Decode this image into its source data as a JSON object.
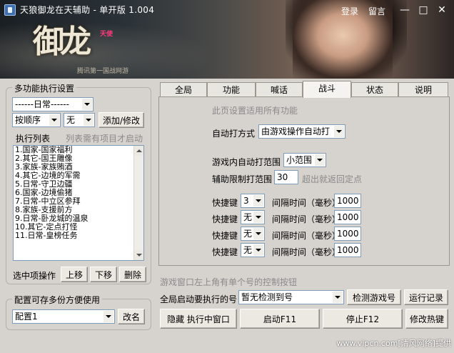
{
  "window": {
    "title": "天狼御龙在天辅助 - 单开版 1.004",
    "login": "登录",
    "message": "留言",
    "minimize": "—",
    "maximize": "□",
    "close": "✕"
  },
  "banner": {
    "logo_text": "御龙",
    "logo_badge": "天使",
    "logo_sub": "腾讯第一国战网游"
  },
  "left": {
    "multi_group_title": "多功能执行设置",
    "daily_combo": "------日常------",
    "order_combo": "按顺序",
    "none_combo": "无",
    "add_modify": "添加/修改",
    "exec_list_label": "执行列表",
    "exec_list_hint": "列表需有项目才启动",
    "list_items": [
      "1.国家-国家福利",
      "2.其它-国王雕像",
      "3.家族-家族贿酒",
      "4.其它-边境的军需",
      "5.日常-守卫边疆",
      "6.国家-边境偷猪",
      "7.日常-中立区参拜",
      "8.家族-支援前方",
      "9.日常-卧龙城的温泉",
      "10.其它-定点打怪",
      "11.日常-皇榜任务"
    ],
    "selected_ops_label": "选中项操作",
    "move_up": "上移",
    "move_down": "下移",
    "delete": "删除",
    "config_group_title": "配置可存多份方便使用",
    "config_combo": "配置1",
    "rename": "改名"
  },
  "tabs": [
    "全局",
    "功能",
    "喊话",
    "战斗",
    "状态",
    "说明"
  ],
  "active_tab": "战斗",
  "battle": {
    "note": "此页设置适用所有功能",
    "auto_mode_label": "自动打方式",
    "auto_mode_value": "由游戏操作自动打",
    "range_label": "游戏内自动打范围",
    "range_value": "小范围",
    "limit_label": "辅助限制打范围",
    "limit_value": "30",
    "limit_hint": "超出就返回定点",
    "hotkeys": [
      {
        "label": "快捷键",
        "key": "3",
        "interval_label": "间隔时间（毫秒）",
        "interval": "1000"
      },
      {
        "label": "快捷键",
        "key": "无",
        "interval_label": "间隔时间（毫秒）",
        "interval": "1000"
      },
      {
        "label": "快捷键",
        "key": "无",
        "interval_label": "间隔时间（毫秒）",
        "interval": "1000"
      },
      {
        "label": "快捷键",
        "key": "无",
        "interval_label": "间隔时间（毫秒）",
        "interval": "1000"
      }
    ]
  },
  "bottom": {
    "hint": "游戏窗口左上角有单个号的控制按钮",
    "global_label": "全局启动要执行的号",
    "global_combo": "暂无检测到号",
    "detect_btn": "检测游戏号",
    "run_log_btn": "运行记录",
    "hide_btn": "隐藏 执行中窗口",
    "start_btn": "启动F11",
    "stop_btn": "停止F12",
    "hotkey_btn": "修改热键"
  },
  "watermark": "www.vipcn.com[清风网络]提供"
}
